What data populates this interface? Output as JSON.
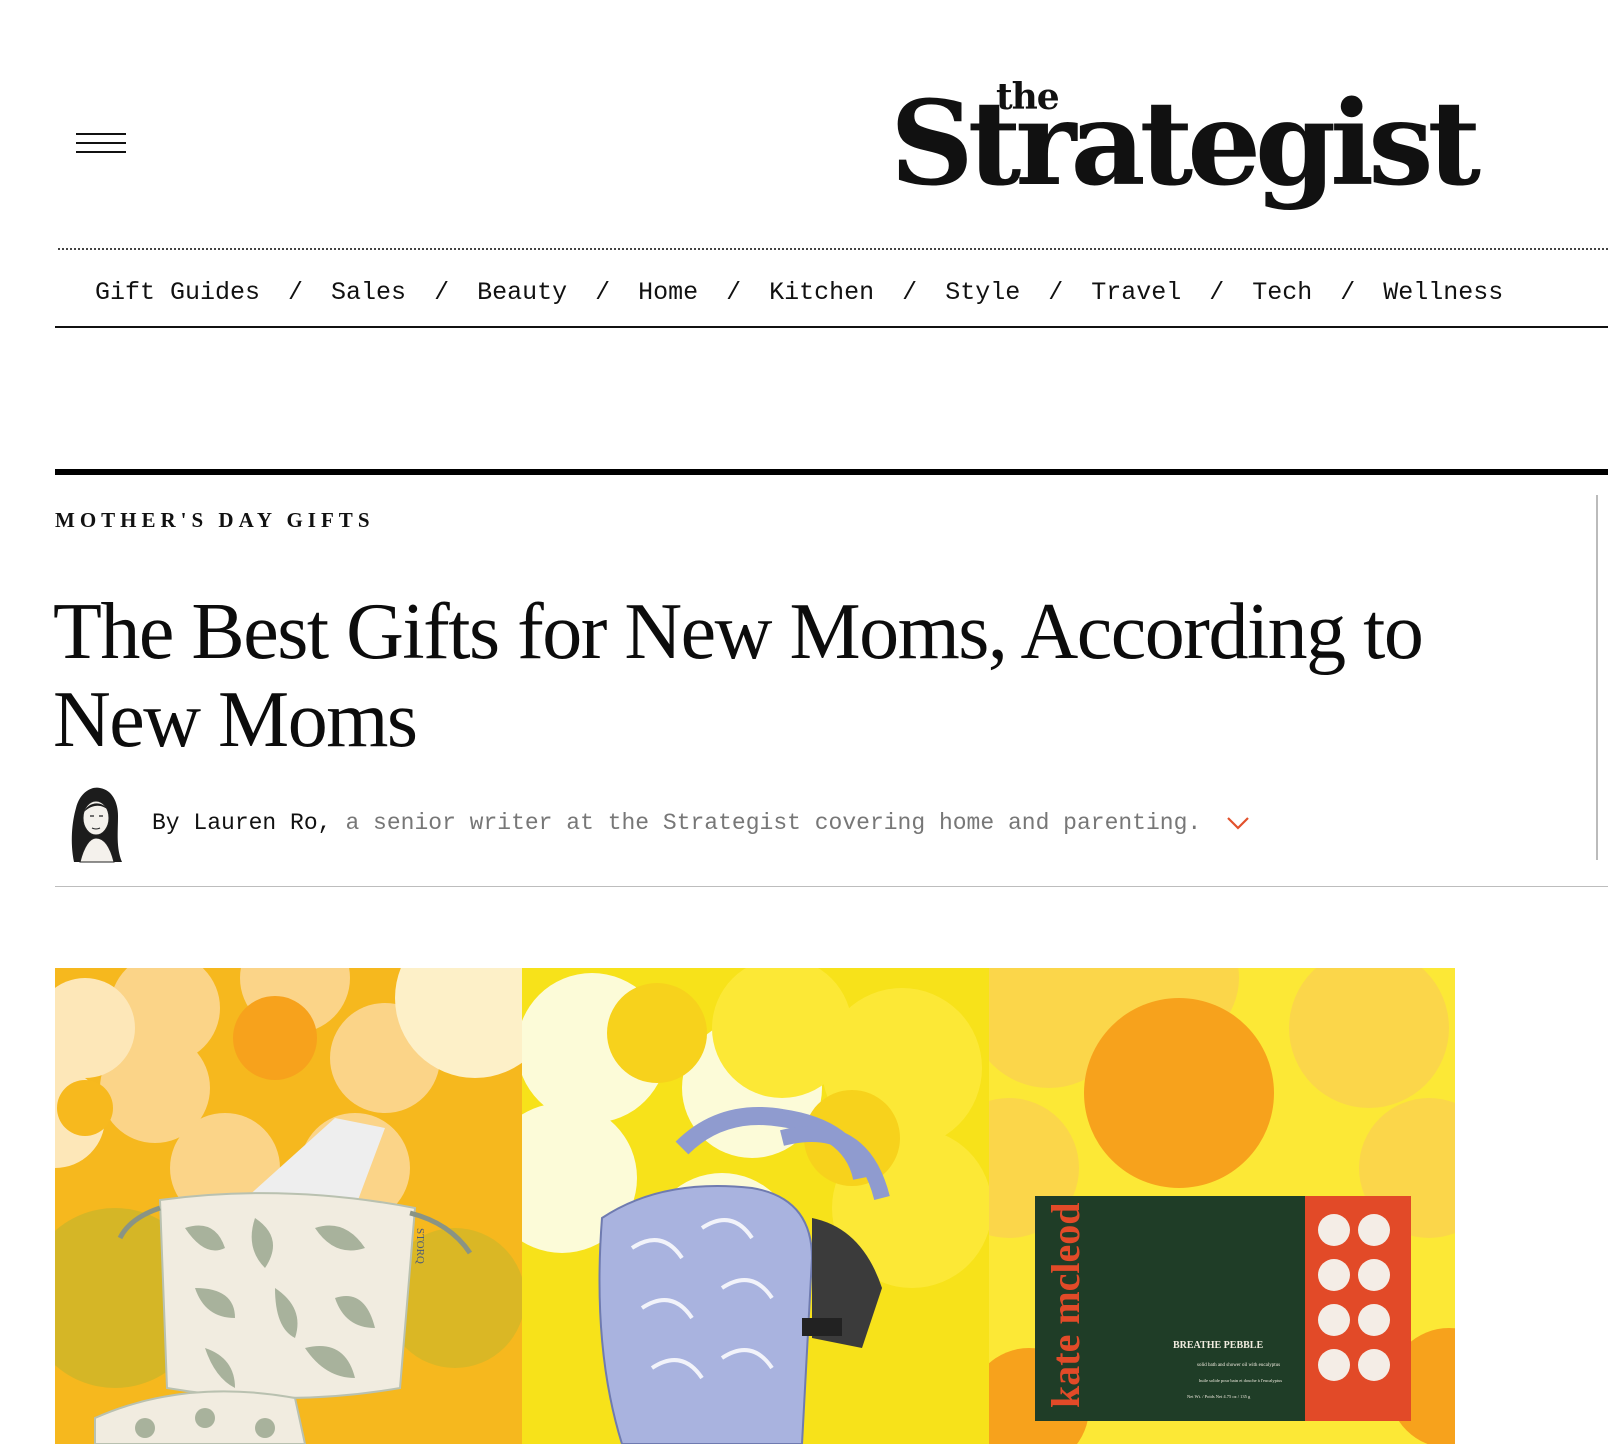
{
  "header": {
    "logo_small": "the",
    "logo_main": "Strategist"
  },
  "nav": {
    "items": [
      "Gift Guides",
      "Sales",
      "Beauty",
      "Home",
      "Kitchen",
      "Style",
      "Travel",
      "Tech",
      "Wellness"
    ],
    "separator": "/"
  },
  "article": {
    "rubric": "Mother's Day Gifts",
    "headline": "The Best Gifts for New Moms, According to New Moms",
    "byline_prefix": "By",
    "author": "Lauren Ro,",
    "author_description": "a senior writer at the Strategist covering home and parenting."
  },
  "hero": {
    "product_brand_1": "STORQ",
    "product_brand_3": "kate mcleod",
    "product_name_3": "BREATHE PEBBLE",
    "product_desc_3": "solid bath and shower oil with eucalyptus",
    "product_desc_3_fr": "huile solide pour bain et douche à l'eucalyptus",
    "product_weight_3": "Net Wt. / Poids Net 4.75 oz / 135 g"
  },
  "colors": {
    "accent_chevron": "#e2512c",
    "hero_yellow": "#f7d21c",
    "hero_orange": "#f7a21c"
  }
}
